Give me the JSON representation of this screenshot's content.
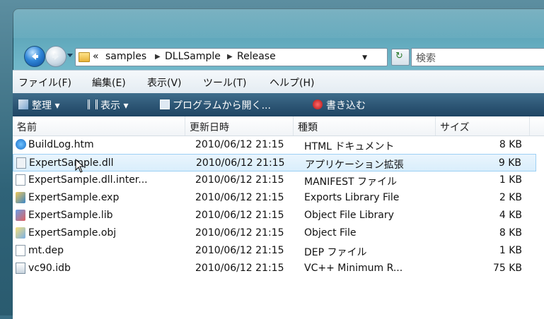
{
  "address": {
    "prefix": "«",
    "crumbs": [
      "samples",
      "DLLSample",
      "Release"
    ],
    "search_placeholder": "検索"
  },
  "menu": [
    "ファイル(F)",
    "編集(E)",
    "表示(V)",
    "ツール(T)",
    "ヘルプ(H)"
  ],
  "toolbar": {
    "organize": "整理 ▾",
    "views": "表示 ▾",
    "open_with": "プログラムから開く...",
    "burn": "書き込む"
  },
  "columns": [
    "名前",
    "更新日時",
    "種類",
    "サイズ"
  ],
  "files": [
    {
      "name": "BuildLog.htm",
      "date": "2010/06/12 21:15",
      "type": "HTML ドキュメント",
      "size": "8 KB",
      "icon": "ie-document-icon"
    },
    {
      "name": "ExpertSample.dll",
      "date": "2010/06/12 21:15",
      "type": "アプリケーション拡張",
      "size": "9 KB",
      "icon": "dll-icon"
    },
    {
      "name": "ExpertSample.dll.inter...",
      "date": "2010/06/12 21:15",
      "type": "MANIFEST ファイル",
      "size": "1 KB",
      "icon": "blank-file-icon"
    },
    {
      "name": "ExpertSample.exp",
      "date": "2010/06/12 21:15",
      "type": "Exports Library File",
      "size": "2 KB",
      "icon": "exp-file-icon"
    },
    {
      "name": "ExpertSample.lib",
      "date": "2010/06/12 21:15",
      "type": "Object File Library",
      "size": "4 KB",
      "icon": "lib-file-icon"
    },
    {
      "name": "ExpertSample.obj",
      "date": "2010/06/12 21:15",
      "type": "Object File",
      "size": "8 KB",
      "icon": "obj-file-icon"
    },
    {
      "name": "mt.dep",
      "date": "2010/06/12 21:15",
      "type": "DEP ファイル",
      "size": "1 KB",
      "icon": "blank-file-icon"
    },
    {
      "name": "vc90.idb",
      "date": "2010/06/12 21:15",
      "type": "VC++ Minimum R...",
      "size": "75 KB",
      "icon": "idb-file-icon"
    }
  ],
  "selected_index": 1
}
